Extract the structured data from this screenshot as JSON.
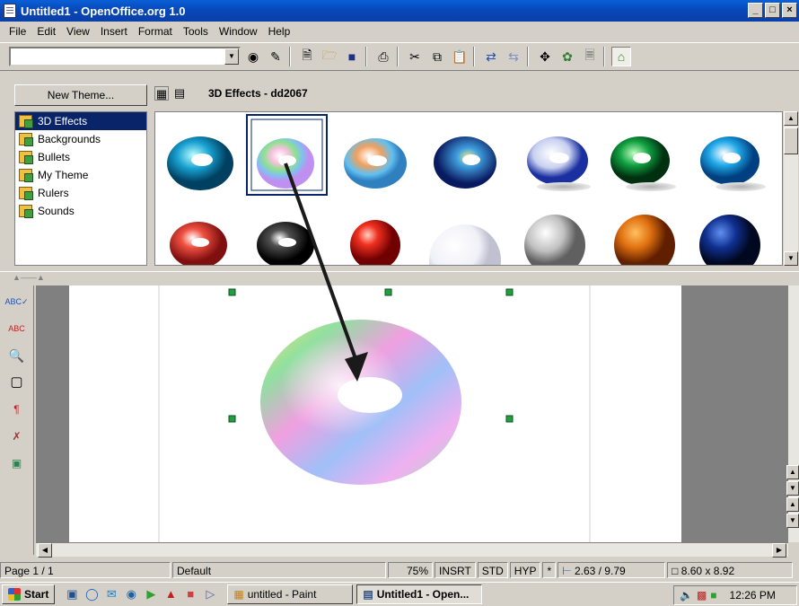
{
  "window": {
    "title": "Untitled1 - OpenOffice.org 1.0",
    "controls": [
      "_",
      "×"
    ]
  },
  "menu": [
    "File",
    "Edit",
    "View",
    "Insert",
    "Format",
    "Tools",
    "Window",
    "Help"
  ],
  "toolbar": {
    "combo_value": "",
    "icons": [
      "navigator-icon",
      "edit-file-icon",
      "new-icon",
      "open-icon",
      "save-icon",
      "print-icon",
      "cut-icon",
      "copy-icon",
      "paste-icon",
      "undo-icon",
      "redo-icon",
      "navigator-star-icon",
      "gallery-icon",
      "data-sources-icon",
      "gallery-active-icon"
    ]
  },
  "gallery": {
    "new_theme_label": "New Theme...",
    "title": "3D Effects - dd2067",
    "themes": [
      "3D Effects",
      "Backgrounds",
      "Bullets",
      "My Theme",
      "Rulers",
      "Sounds"
    ],
    "selected_theme": "3D Effects"
  },
  "status": {
    "page": "Page 1 / 1",
    "style": "Default",
    "zoom": "75%",
    "insert": "INSRT",
    "std": "STD",
    "hyp": "HYP",
    "star": "*",
    "position": "2.63 / 9.79",
    "size": "8.60 x 8.92"
  },
  "taskbar": {
    "start": "Start",
    "tasks": [
      "untitled - Paint",
      "Untitled1 - Open..."
    ],
    "time": "12:26 PM"
  },
  "colors": {
    "title_bar": "#0a4cc0",
    "selection": "#0a246a",
    "arrow": "#1a1a1a"
  }
}
